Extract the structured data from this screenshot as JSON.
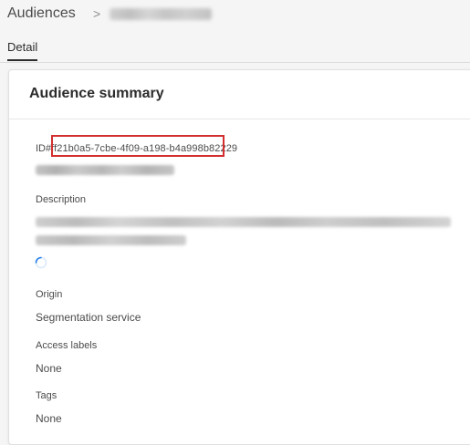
{
  "breadcrumb": {
    "root": "Audiences",
    "separator": ">"
  },
  "tabs": [
    {
      "label": "Detail",
      "active": true
    }
  ],
  "summary": {
    "title": "Audience summary",
    "id_prefix": "ID#",
    "id_value": "ff21b0a5-7cbe-4f09-a198-b4a998b82229",
    "description_label": "Description",
    "origin_label": "Origin",
    "origin_value": "Segmentation service",
    "access_labels_label": "Access labels",
    "access_labels_value": "None",
    "tags_label": "Tags",
    "tags_value": "None"
  },
  "colors": {
    "highlight_box": "#d32f2f",
    "spinner": "#2680eb"
  },
  "icons": {
    "breadcrumb_separator": "chevron-right-icon",
    "loading": "spinner-icon"
  }
}
